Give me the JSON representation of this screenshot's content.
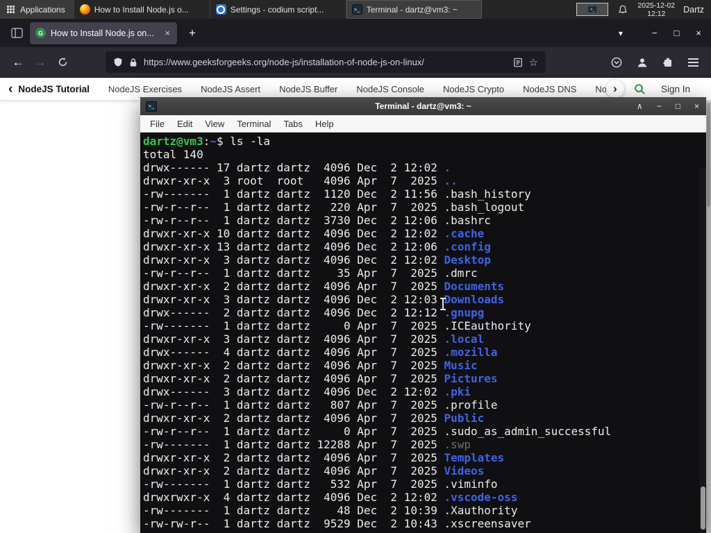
{
  "colors": {
    "gfg_green": "#2f8d46",
    "prompt_green": "#33c74e",
    "dir_blue": "#3f63e6",
    "dim_file": "#6e6e6e",
    "terminal_bg": "#101013",
    "panel_bg": "#262626"
  },
  "icons": {
    "back": "←",
    "forward": "→",
    "new_tab": "+",
    "close": "×",
    "minimize": "−",
    "maximize": "□",
    "shade": "∧",
    "list_tabs": "▾",
    "star": "☆",
    "nav_prev": "‹",
    "nav_next": "›"
  },
  "panel": {
    "applications": "Applications",
    "tasks": [
      {
        "title": "How to Install Node.js o...",
        "icon": "firefox"
      },
      {
        "title": "Settings - codium script...",
        "icon": "settings"
      },
      {
        "title": "Terminal - dartz@vm3: ~",
        "icon": "terminal"
      }
    ],
    "clock_date": "2025-12-02",
    "clock_time": "12:12",
    "user": "Dartz"
  },
  "browser": {
    "tab_title": "How to Install Node.js on...",
    "url": "https://www.geeksforgeeks.org/node-js/installation-of-node-js-on-linux/"
  },
  "site_nav": {
    "items": [
      "NodeJS Tutorial",
      "NodeJS Exercises",
      "NodeJS Assert",
      "NodeJS Buffer",
      "NodeJS Console",
      "NodeJS Crypto",
      "NodeJS DNS",
      "Node"
    ],
    "sign_in": "Sign In"
  },
  "terminal": {
    "title": "Terminal - dartz@vm3: ~",
    "menu": [
      "File",
      "Edit",
      "View",
      "Terminal",
      "Tabs",
      "Help"
    ],
    "prompt_user": "dartz@vm3",
    "prompt_colon": ":",
    "prompt_path": "~",
    "prompt_dollar": "$ ",
    "command": "ls -la",
    "total": "total 140",
    "listing": [
      {
        "text": "drwx------ 17 dartz dartz  4096 Dec  2 12:02 ",
        "name": ".",
        "type": "dir"
      },
      {
        "text": "drwxr-xr-x  3 root  root   4096 Apr  7  2025 ",
        "name": "..",
        "type": "dir"
      },
      {
        "text": "-rw-------  1 dartz dartz  1120 Dec  2 11:56 ",
        "name": ".bash_history",
        "type": "file"
      },
      {
        "text": "-rw-r--r--  1 dartz dartz   220 Apr  7  2025 ",
        "name": ".bash_logout",
        "type": "file"
      },
      {
        "text": "-rw-r--r--  1 dartz dartz  3730 Dec  2 12:06 ",
        "name": ".bashrc",
        "type": "file"
      },
      {
        "text": "drwxr-xr-x 10 dartz dartz  4096 Dec  2 12:02 ",
        "name": ".cache",
        "type": "dir"
      },
      {
        "text": "drwxr-xr-x 13 dartz dartz  4096 Dec  2 12:06 ",
        "name": ".config",
        "type": "dir"
      },
      {
        "text": "drwxr-xr-x  3 dartz dartz  4096 Dec  2 12:02 ",
        "name": "Desktop",
        "type": "dir"
      },
      {
        "text": "-rw-r--r--  1 dartz dartz    35 Apr  7  2025 ",
        "name": ".dmrc",
        "type": "file"
      },
      {
        "text": "drwxr-xr-x  2 dartz dartz  4096 Apr  7  2025 ",
        "name": "Documents",
        "type": "dir"
      },
      {
        "text": "drwxr-xr-x  3 dartz dartz  4096 Dec  2 12:03 ",
        "name": "Downloads",
        "type": "dir"
      },
      {
        "text": "drwx------  2 dartz dartz  4096 Dec  2 12:12 ",
        "name": ".gnupg",
        "type": "dir"
      },
      {
        "text": "-rw-------  1 dartz dartz     0 Apr  7  2025 ",
        "name": ".ICEauthority",
        "type": "file"
      },
      {
        "text": "drwxr-xr-x  3 dartz dartz  4096 Apr  7  2025 ",
        "name": ".local",
        "type": "dir"
      },
      {
        "text": "drwx------  4 dartz dartz  4096 Apr  7  2025 ",
        "name": ".mozilla",
        "type": "dir"
      },
      {
        "text": "drwxr-xr-x  2 dartz dartz  4096 Apr  7  2025 ",
        "name": "Music",
        "type": "dir"
      },
      {
        "text": "drwxr-xr-x  2 dartz dartz  4096 Apr  7  2025 ",
        "name": "Pictures",
        "type": "dir"
      },
      {
        "text": "drwx------  3 dartz dartz  4096 Dec  2 12:02 ",
        "name": ".pki",
        "type": "dir"
      },
      {
        "text": "-rw-r--r--  1 dartz dartz   807 Apr  7  2025 ",
        "name": ".profile",
        "type": "file"
      },
      {
        "text": "drwxr-xr-x  2 dartz dartz  4096 Apr  7  2025 ",
        "name": "Public",
        "type": "dir"
      },
      {
        "text": "-rw-r--r--  1 dartz dartz     0 Apr  7  2025 ",
        "name": ".sudo_as_admin_successful",
        "type": "file"
      },
      {
        "text": "-rw-------  1 dartz dartz 12288 Apr  7  2025 ",
        "name": ".swp",
        "type": "dim"
      },
      {
        "text": "drwxr-xr-x  2 dartz dartz  4096 Apr  7  2025 ",
        "name": "Templates",
        "type": "dir"
      },
      {
        "text": "drwxr-xr-x  2 dartz dartz  4096 Apr  7  2025 ",
        "name": "Videos",
        "type": "dir"
      },
      {
        "text": "-rw-------  1 dartz dartz   532 Apr  7  2025 ",
        "name": ".viminfo",
        "type": "file"
      },
      {
        "text": "drwxrwxr-x  4 dartz dartz  4096 Dec  2 12:02 ",
        "name": ".vscode-oss",
        "type": "dir"
      },
      {
        "text": "-rw-------  1 dartz dartz    48 Dec  2 10:39 ",
        "name": ".Xauthority",
        "type": "file"
      },
      {
        "text": "-rw-rw-r--  1 dartz dartz  9529 Dec  2 10:43 ",
        "name": ".xscreensaver",
        "type": "file"
      }
    ]
  }
}
